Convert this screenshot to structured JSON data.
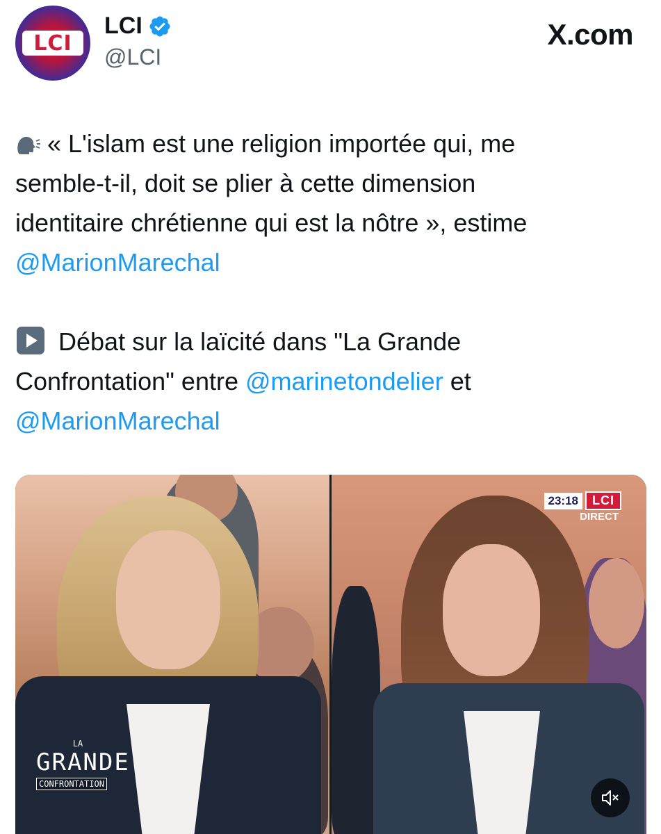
{
  "header": {
    "avatar_text": "LCI",
    "display_name": "LCI",
    "handle": "@LCI",
    "site": "X.com"
  },
  "tweet": {
    "line1_pre": "« L'islam est une religion importée qui, me",
    "line2": "semble-t-il, doit se plier à cette dimension",
    "line3": "identitaire chrétienne qui est la nôtre », estime",
    "mention_marion": "@MarionMarechal",
    "line5_pre": "Débat sur la laïcité dans \"La Grande",
    "line6_pre": "Confrontation\" entre",
    "mention_marine": "@marinetondelier",
    "line6_post": "et",
    "mention_marion_2": "@MarionMarechal"
  },
  "media": {
    "time": "23:18",
    "channel": "LCI",
    "live_label": "DIRECT",
    "show_logo_top": "LA",
    "show_logo_main": "GRANDE",
    "show_logo_bottom": "CONFRONTATION"
  },
  "icons": {
    "speaking": "speaking-head-icon",
    "play": "play-button-icon",
    "mute": "speaker-muted-icon",
    "verified": "verified-badge-icon"
  },
  "colors": {
    "mention": "#1d9bf0",
    "verified": "#1d9bf0",
    "lci_red": "#d01c3a",
    "handle_gray": "#536471"
  }
}
